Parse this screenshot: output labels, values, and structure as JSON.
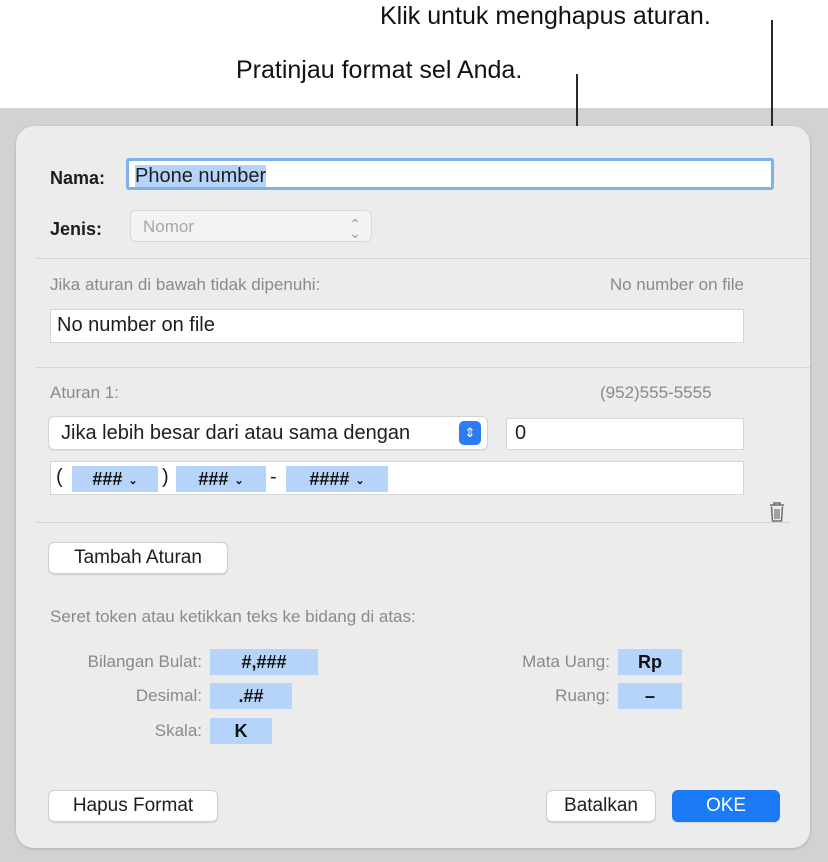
{
  "callouts": {
    "delete_rule": "Klik untuk menghapus aturan.",
    "preview": "Pratinjau format sel Anda."
  },
  "form": {
    "name_label": "Nama:",
    "name_value": "Phone number",
    "type_label": "Jenis:",
    "type_value": "Nomor"
  },
  "unmet": {
    "label": "Jika aturan di bawah tidak dipenuhi:",
    "preview": "No number on file",
    "value": "No number on file"
  },
  "rule1": {
    "label": "Aturan 1:",
    "preview": "(952)555-5555",
    "condition": "Jika lebih besar dari atau sama dengan",
    "threshold": "0",
    "format_tokens": [
      {
        "type": "text",
        "value": "("
      },
      {
        "type": "token",
        "value": "###"
      },
      {
        "type": "text",
        "value": ")"
      },
      {
        "type": "token",
        "value": "###"
      },
      {
        "type": "text",
        "value": "-"
      },
      {
        "type": "token",
        "value": "####"
      }
    ]
  },
  "buttons": {
    "add_rule": "Tambah Aturan",
    "clear_format": "Hapus Format",
    "cancel": "Batalkan",
    "ok": "OKE"
  },
  "tokens_help": "Seret token atau ketikkan teks ke bidang di atas:",
  "token_palette": {
    "integer_label": "Bilangan Bulat:",
    "integer_token": "#,###",
    "decimal_label": "Desimal:",
    "decimal_token": ".##",
    "scale_label": "Skala:",
    "scale_token": "K",
    "currency_label": "Mata Uang:",
    "currency_token": "Rp",
    "space_label": "Ruang:",
    "space_token": "–"
  },
  "icons": {
    "delete": "trash-icon",
    "popup_chevron": "chevron-up-down-icon",
    "token_chevron": "chevron-down-icon"
  },
  "colors": {
    "accent": "#1a7af8",
    "token_fill": "#b6d4fa",
    "dialog_bg": "#ececec"
  }
}
